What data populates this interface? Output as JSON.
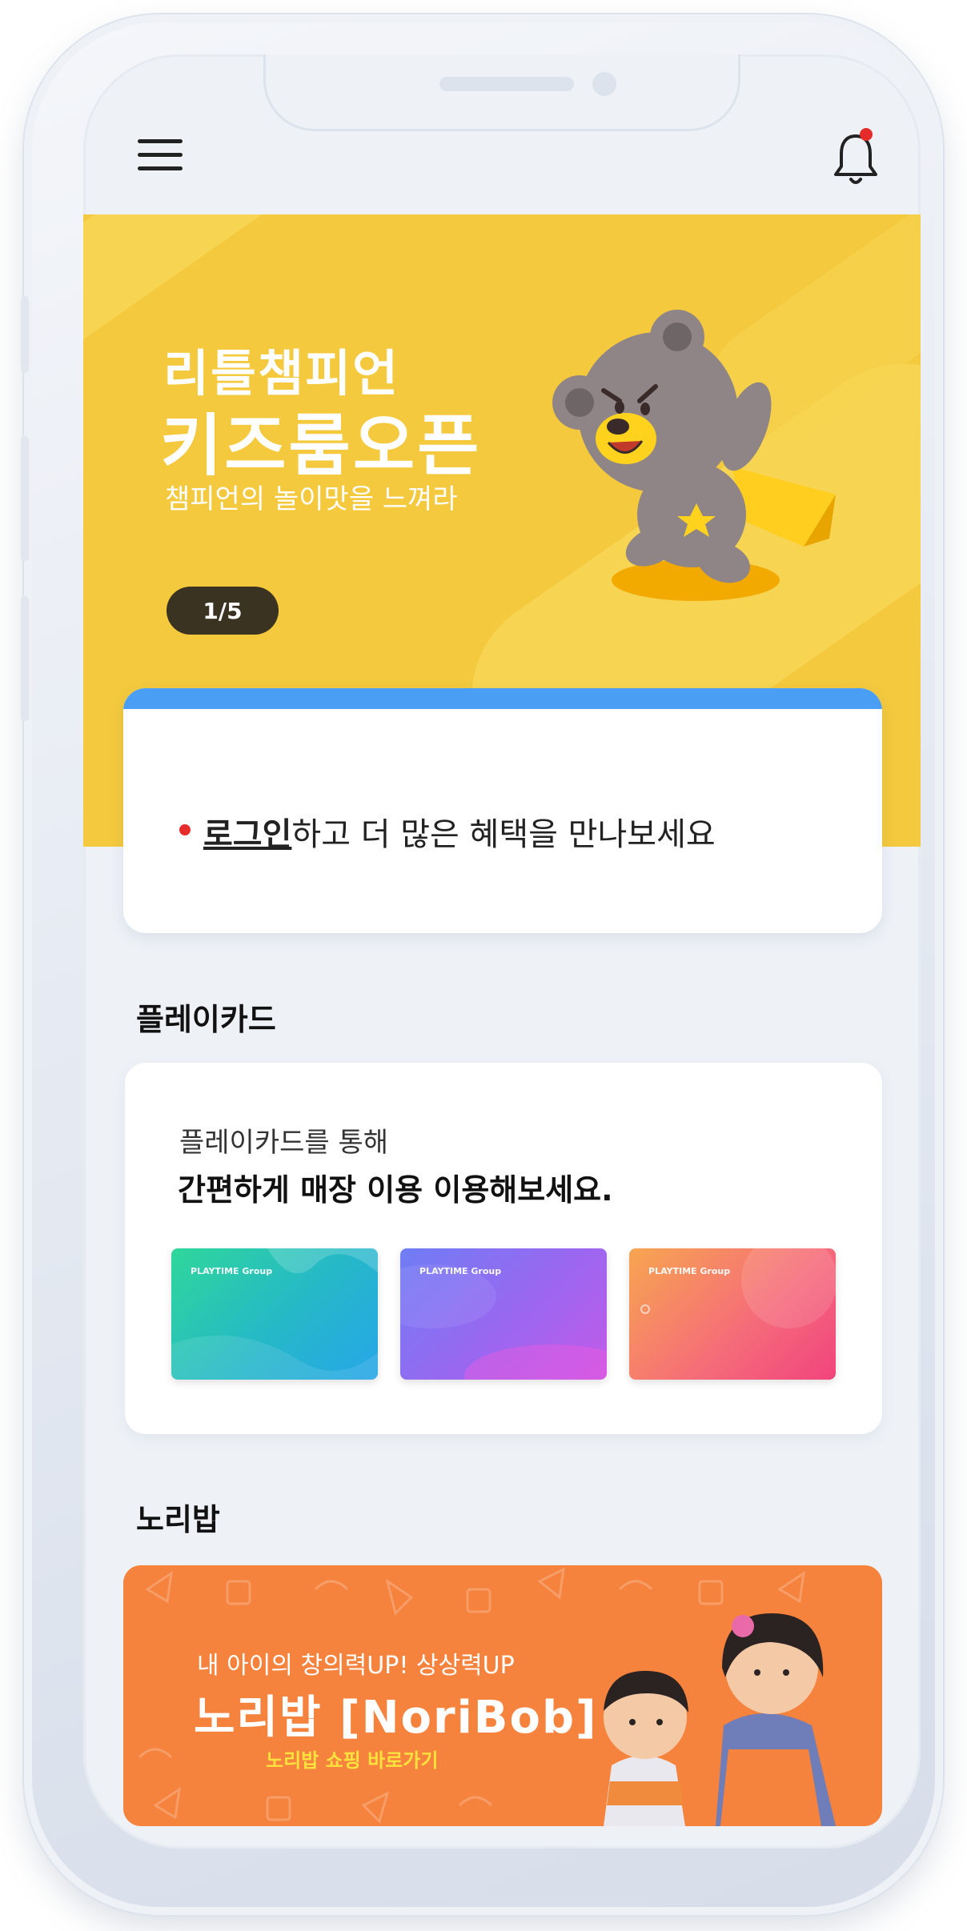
{
  "header": {
    "menu_icon": "hamburger-menu-icon",
    "bell_icon": "bell-icon",
    "notification_dot_color": "#e62b2b"
  },
  "banner": {
    "title_line1": "리틀챔피언",
    "title_line2": "키즈룸오픈",
    "subtitle": "챔피언의 놀이맛을 느껴라",
    "page_counter": "1/5",
    "background_color": "#f4c93d",
    "illustration": "bear-character-with-cape"
  },
  "login_card": {
    "link_text": "로그인",
    "message_text": "하고 더 많은 혜택을 만나보세요",
    "accent_color": "#4a9ff5"
  },
  "playcard_section": {
    "title": "플레이카드",
    "line1": "플레이카드를 통해",
    "line2": "간편하게 매장 이용 이용해보세요.",
    "cards": [
      {
        "brand": "PLAYTIME Group",
        "theme": "green-blue"
      },
      {
        "brand": "PLAYTIME Group",
        "theme": "purple"
      },
      {
        "brand": "PLAYTIME Group",
        "theme": "orange-pink"
      }
    ]
  },
  "noribob_section": {
    "title": "노리밥",
    "promo_line1": "내 아이의 창의력UP! 상상력UP",
    "promo_title": "노리밥 [NoriBob]",
    "promo_link": "노리밥 쇼핑 바로가기",
    "background_color": "#f5823d"
  }
}
